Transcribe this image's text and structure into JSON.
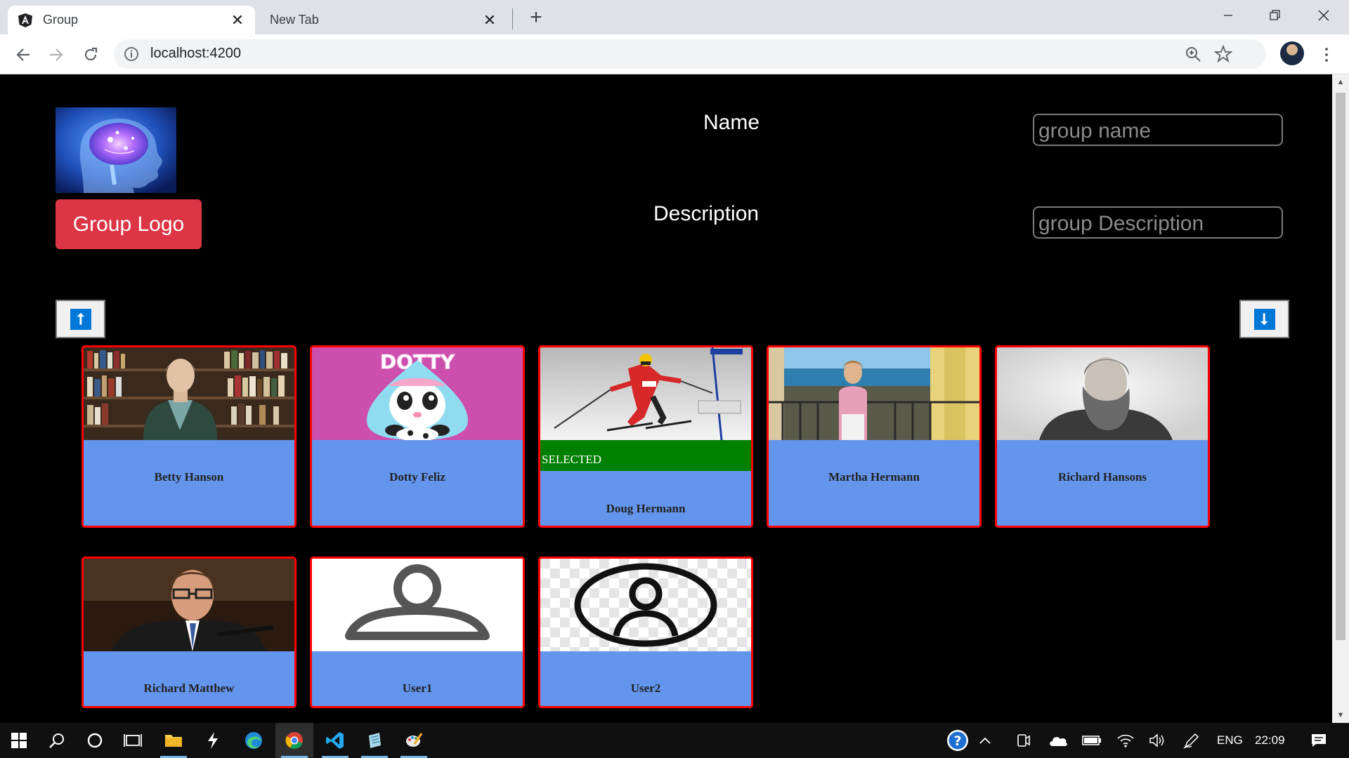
{
  "browser": {
    "tabs": [
      {
        "title": "Group",
        "active": true
      },
      {
        "title": "New Tab",
        "active": false
      }
    ],
    "url": "localhost:4200"
  },
  "form": {
    "logo_button": "Group Logo",
    "name_label": "Name",
    "name_placeholder": "group name",
    "description_label": "Description",
    "description_placeholder": "group Description"
  },
  "sort": {
    "up_glyph": "⭡",
    "down_glyph": "⭣"
  },
  "users": [
    {
      "name": "Betty Hanson",
      "photo": "bookshelf-woman-photo",
      "selected": false
    },
    {
      "name": "Dotty Feliz",
      "photo": "dotty-cartoon-photo",
      "selected": false
    },
    {
      "name": "Doug Hermann",
      "photo": "skier-photo",
      "selected": true,
      "selected_label": "SELECTED"
    },
    {
      "name": "Martha Hermann",
      "photo": "balcony-woman-photo",
      "selected": false
    },
    {
      "name": "Richard Hansons",
      "photo": "bearded-man-portrait-photo",
      "selected": false
    },
    {
      "name": "Richard Matthew",
      "photo": "speaker-man-photo",
      "selected": false
    },
    {
      "name": "User1",
      "photo": "default-user-icon",
      "selected": false
    },
    {
      "name": "User2",
      "photo": "circle-user-icon",
      "selected": false
    }
  ],
  "taskbar": {
    "language": "ENG",
    "time": "22:09"
  }
}
